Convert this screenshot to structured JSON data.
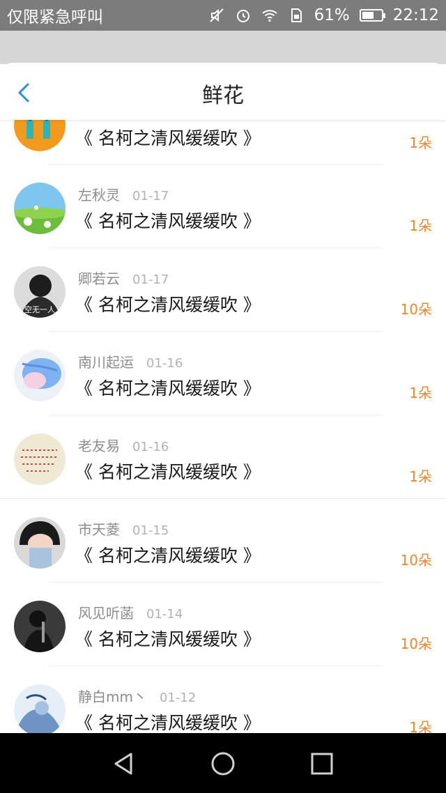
{
  "status_bar": {
    "carrier": "仅限紧急呼叫",
    "battery_percent": "61%",
    "battery_level": 0.61,
    "time": "22:12",
    "icons": [
      "mute-icon",
      "alarm-icon",
      "wifi-icon",
      "sim-icon",
      "battery-icon"
    ]
  },
  "header": {
    "title": "鲜花",
    "back_icon": "chevron-left-icon"
  },
  "items": [
    {
      "name": "",
      "date": "",
      "book": "《 名柯之清风缓缓吹 》",
      "count": "1朵"
    },
    {
      "name": "左秋灵",
      "date": "01-17",
      "book": "《 名柯之清风缓缓吹 》",
      "count": "1朵"
    },
    {
      "name": "卿若云",
      "date": "01-17",
      "book": "《 名柯之清风缓缓吹 》",
      "count": "10朵"
    },
    {
      "name": "南川起运",
      "date": "01-16",
      "book": "《 名柯之清风缓缓吹 》",
      "count": "1朵"
    },
    {
      "name": "老友易",
      "date": "01-16",
      "book": "《 名柯之清风缓缓吹 》",
      "count": "1朵"
    },
    {
      "name": "市天菱",
      "date": "01-15",
      "book": "《 名柯之清风缓缓吹 》",
      "count": "10朵"
    },
    {
      "name": "风见听菡",
      "date": "01-14",
      "book": "《 名柯之清风缓缓吹 》",
      "count": "10朵"
    },
    {
      "name": "静白mm丶",
      "date": "01-12",
      "book": "《 名柯之清风缓缓吹 》",
      "count": "1朵"
    }
  ],
  "avatar_text": {
    "row3": "空无一人"
  },
  "nav": {
    "icons": [
      "back-triangle-icon",
      "home-circle-icon",
      "recents-square-icon"
    ]
  },
  "colors": {
    "accent": "#f0862a",
    "back": "#2a8ee6"
  }
}
